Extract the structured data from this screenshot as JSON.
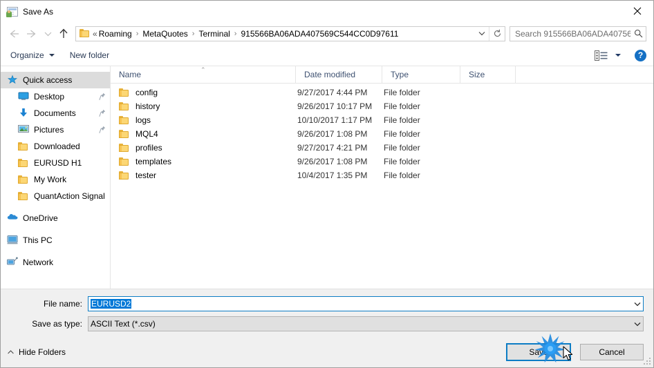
{
  "window": {
    "title": "Save As",
    "title_icon": "save-as-icon",
    "close_icon": "close-icon"
  },
  "address_bar": {
    "back_icon": "arrow-left-icon",
    "forward_icon": "arrow-right-icon",
    "recent_icon": "chevron-down-icon",
    "up_icon": "arrow-up-icon",
    "folder_icon": "folder-icon",
    "overflow": "«",
    "breadcrumbs": [
      "Roaming",
      "MetaQuotes",
      "Terminal",
      "915566BA06ADA407569C544CC0D97611"
    ],
    "separator": "›",
    "dropdown_icon": "chevron-down-icon",
    "refresh_icon": "refresh-icon",
    "search": {
      "placeholder": "Search 915566BA06ADA40756...",
      "icon": "search-icon"
    }
  },
  "toolbar": {
    "organize_label": "Organize",
    "new_folder_label": "New folder",
    "view_icon": "view-layout-icon",
    "view_dropdown_icon": "chevron-down-icon",
    "help_icon": "help-icon",
    "help_label": "?"
  },
  "sidebar": {
    "items": [
      {
        "label": "Quick access",
        "icon": "star-pin-icon",
        "level": 0,
        "selected": true,
        "pinned": false
      },
      {
        "label": "Desktop",
        "icon": "desktop-icon",
        "level": 1,
        "selected": false,
        "pinned": true
      },
      {
        "label": "Documents",
        "icon": "documents-download-icon",
        "level": 1,
        "selected": false,
        "pinned": true
      },
      {
        "label": "Pictures",
        "icon": "pictures-icon",
        "level": 1,
        "selected": false,
        "pinned": true
      },
      {
        "label": "Downloaded",
        "icon": "folder-icon",
        "level": 1,
        "selected": false,
        "pinned": false
      },
      {
        "label": "EURUSD H1",
        "icon": "folder-icon",
        "level": 1,
        "selected": false,
        "pinned": false
      },
      {
        "label": "My Work",
        "icon": "folder-icon",
        "level": 1,
        "selected": false,
        "pinned": false
      },
      {
        "label": "QuantAction Signal",
        "icon": "folder-icon",
        "level": 1,
        "selected": false,
        "pinned": false
      },
      {
        "label": "OneDrive",
        "icon": "onedrive-cloud-icon",
        "level": 0,
        "selected": false,
        "pinned": false,
        "gap": true
      },
      {
        "label": "This PC",
        "icon": "this-pc-icon",
        "level": 0,
        "selected": false,
        "pinned": false,
        "gap": true
      },
      {
        "label": "Network",
        "icon": "network-icon",
        "level": 0,
        "selected": false,
        "pinned": false,
        "gap": true
      }
    ]
  },
  "file_list": {
    "columns": [
      "Name",
      "Date modified",
      "Type",
      "Size"
    ],
    "sort_column": "Name",
    "sort_caret": "⌃",
    "rows": [
      {
        "name": "config",
        "date": "9/27/2017 4:44 PM",
        "type": "File folder",
        "size": "",
        "icon": "folder-icon"
      },
      {
        "name": "history",
        "date": "9/26/2017 10:17 PM",
        "type": "File folder",
        "size": "",
        "icon": "folder-icon"
      },
      {
        "name": "logs",
        "date": "10/10/2017 1:17 PM",
        "type": "File folder",
        "size": "",
        "icon": "folder-icon"
      },
      {
        "name": "MQL4",
        "date": "9/26/2017 1:08 PM",
        "type": "File folder",
        "size": "",
        "icon": "folder-icon"
      },
      {
        "name": "profiles",
        "date": "9/27/2017 4:21 PM",
        "type": "File folder",
        "size": "",
        "icon": "folder-icon"
      },
      {
        "name": "templates",
        "date": "9/26/2017 1:08 PM",
        "type": "File folder",
        "size": "",
        "icon": "folder-icon"
      },
      {
        "name": "tester",
        "date": "10/4/2017 1:35 PM",
        "type": "File folder",
        "size": "",
        "icon": "folder-icon"
      }
    ]
  },
  "form": {
    "file_name_label": "File name:",
    "file_name_value": "EURUSD2",
    "file_name_selected": true,
    "save_as_type_label": "Save as type:",
    "save_as_type_value": "ASCII Text (*.csv)",
    "dropdown_icon": "chevron-down-icon"
  },
  "footer": {
    "hide_folders_label": "Hide Folders",
    "hide_folders_icon": "chevron-up-icon",
    "save_label": "Save",
    "cancel_label": "Cancel",
    "resize_grip_icon": "resize-grip-icon"
  },
  "overlay": {
    "click_burst_icon": "click-burst-icon",
    "cursor_icon": "mouse-cursor-icon",
    "accent_color": "#0c7cc4",
    "selection_color": "#0078d7"
  }
}
